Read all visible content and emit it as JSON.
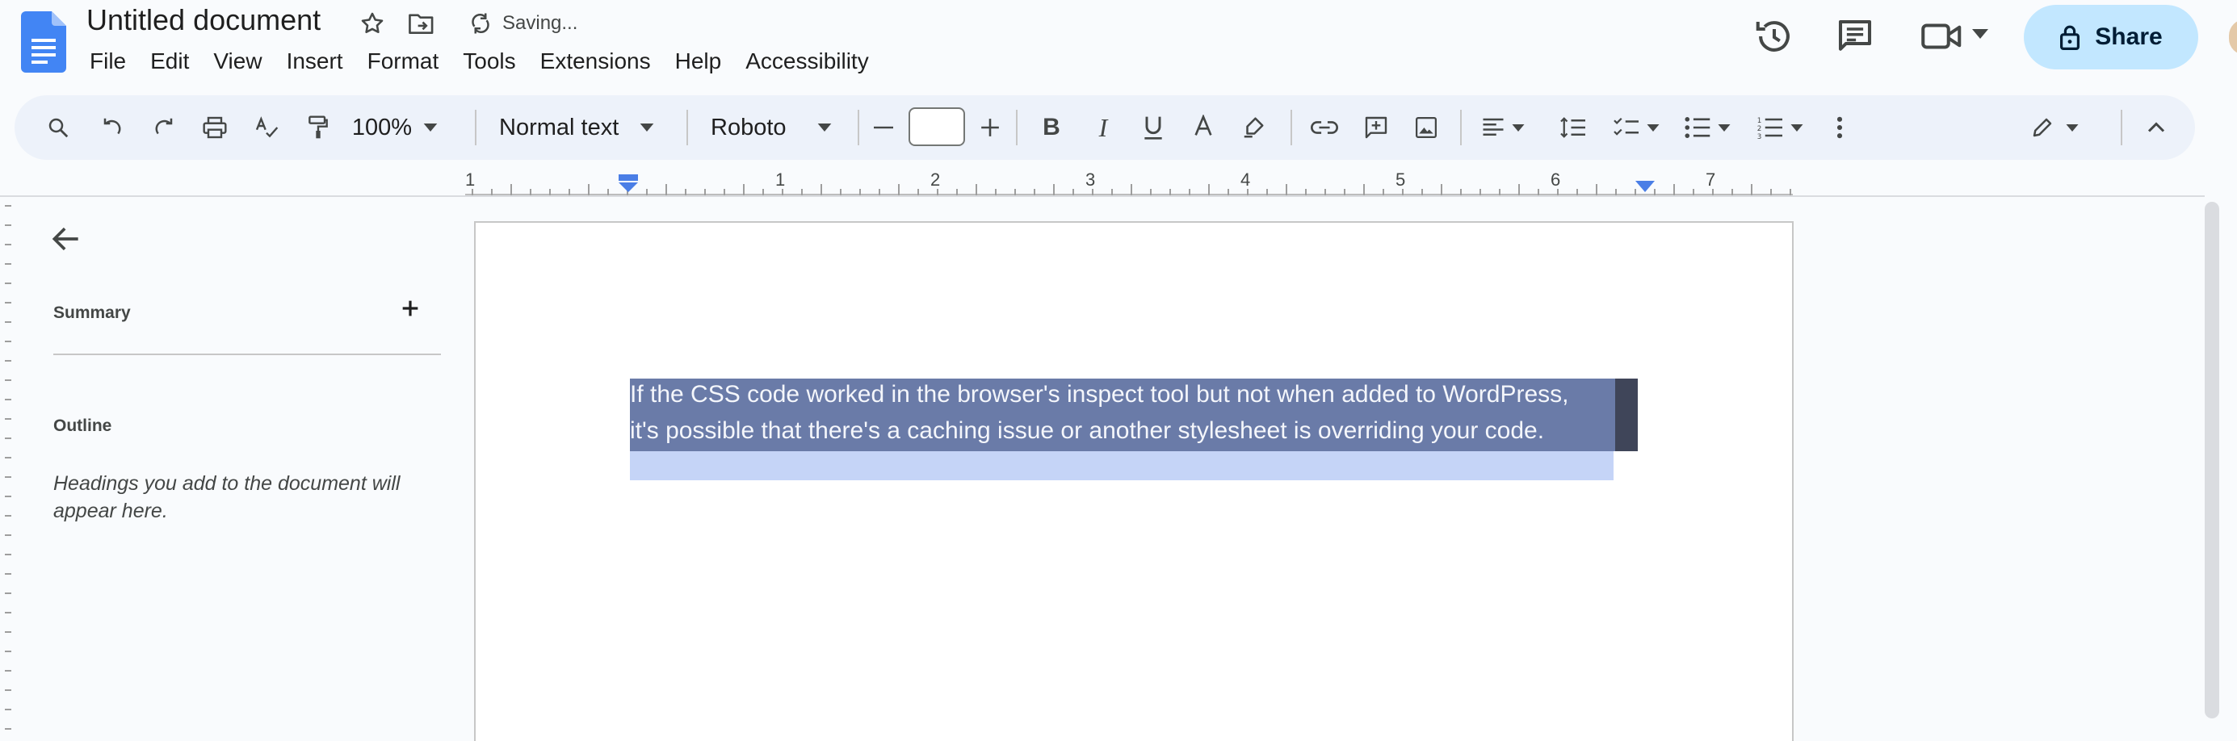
{
  "app": {
    "doc_title": "Untitled document",
    "saving_status": "Saving...",
    "menu": [
      "File",
      "Edit",
      "View",
      "Insert",
      "Format",
      "Tools",
      "Extensions",
      "Help",
      "Accessibility"
    ],
    "share_label": "Share",
    "brand_color": "#4285f4"
  },
  "toolbar": {
    "zoom": "100%",
    "style": "Normal text",
    "font": "Roboto",
    "font_size": ""
  },
  "ruler": {
    "labels": [
      "1",
      "1",
      "2",
      "3",
      "4",
      "5",
      "6",
      "7"
    ]
  },
  "sidebar": {
    "summary_label": "Summary",
    "outline_label": "Outline",
    "outline_hint": "Headings you add to the document will appear here."
  },
  "document": {
    "line1": "If the CSS code worked in the browser's inspect tool but not when added to WordPress,",
    "line2": "it's possible that there's a caching issue or another stylesheet is overriding your code."
  },
  "icons": {
    "star": "star-icon",
    "move": "move-to-folder-icon",
    "history": "version-history-icon",
    "comments": "comments-icon",
    "meet": "video-call-icon",
    "lock": "lock-icon"
  }
}
